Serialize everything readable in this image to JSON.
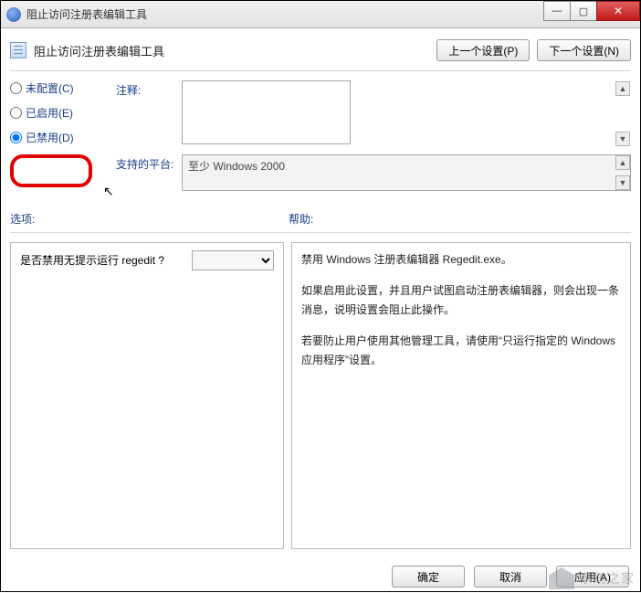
{
  "window": {
    "title": "阻止访问注册表编辑工具"
  },
  "header": {
    "policy_title": "阻止访问注册表编辑工具",
    "prev_button": "上一个设置(P)",
    "next_button": "下一个设置(N)"
  },
  "radios": {
    "not_configured": "未配置(C)",
    "enabled": "已启用(E)",
    "disabled": "已禁用(D)",
    "selected": "disabled"
  },
  "fields": {
    "comment_label": "注释:",
    "comment_value": "",
    "platform_label": "支持的平台:",
    "platform_value": "至少 Windows 2000"
  },
  "mid": {
    "options_label": "选项:",
    "help_label": "帮助:"
  },
  "options": {
    "question": "是否禁用无提示运行 regedit ?",
    "select_value": ""
  },
  "help": {
    "p1": "禁用 Windows 注册表编辑器 Regedit.exe。",
    "p2": "如果启用此设置，并且用户试图启动注册表编辑器，则会出现一条消息，说明设置会阻止此操作。",
    "p3": "若要防止用户使用其他管理工具，请使用“只运行指定的 Windows 应用程序”设置。"
  },
  "footer": {
    "ok": "确定",
    "cancel": "取消",
    "apply": "应用(A)"
  }
}
